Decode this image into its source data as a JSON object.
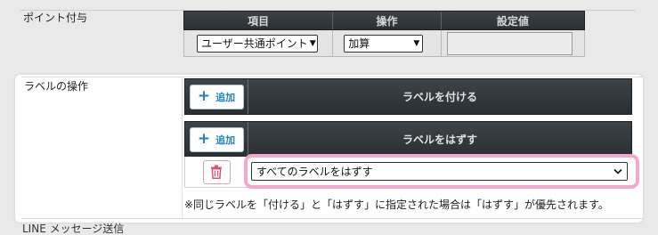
{
  "point_section": {
    "label": "ポイント付与",
    "columns": [
      "項目",
      "操作",
      "設定値"
    ],
    "item_select_value": "ユーザー共通ポイント",
    "operation_select_value": "加算",
    "setting_value": ""
  },
  "label_section": {
    "label": "ラベルの操作",
    "add_label": {
      "add_button": "追加",
      "title": "ラベルを付ける"
    },
    "remove_label": {
      "add_button": "追加",
      "title": "ラベルをはずす",
      "select_value": "すべてのラベルをはずす"
    },
    "note": "※同じラベルを「付ける」と「はずす」に指定された場合は「はずす」が優先されます。"
  },
  "next_section": {
    "label_partial": "LINE メッセージ送信"
  },
  "colors": {
    "header_bg": "#2f3539",
    "accent_blue": "#1f80c8",
    "delete_red": "#e0546a",
    "highlight_pink": "#f2a8cf"
  },
  "icons": {
    "add": "plus-icon",
    "delete": "trash-icon",
    "dropdown": "chevron-down-icon"
  }
}
